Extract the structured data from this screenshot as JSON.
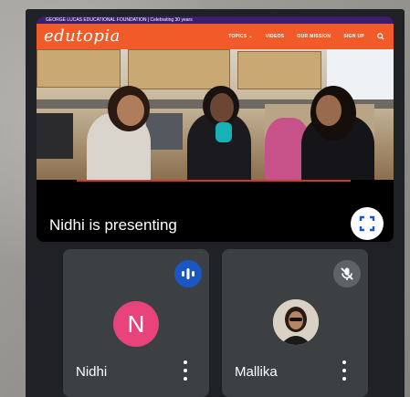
{
  "presentation": {
    "site_banner": "GEORGE LUCAS EDUCATIONAL FOUNDATION  |  Celebrating 30 years",
    "site_logo": "edutopia",
    "nav": [
      "TOPICS ⌄",
      "VIDEOS",
      "OUR MISSION",
      "SIGN UP"
    ],
    "presenter_text": "Nidhi is presenting"
  },
  "participants": [
    {
      "name": "Nidhi",
      "initial": "N",
      "audio": "speaking",
      "avatar_color": "#e8437a"
    },
    {
      "name": "Mallika",
      "audio": "muted"
    }
  ],
  "colors": {
    "background": "#202124",
    "tile": "#3c4043",
    "accent_speaking": "#1a56c4",
    "site_brand": "#f15a29"
  },
  "icons": {
    "fullscreen": "fullscreen-icon",
    "speaking": "audio-level-icon",
    "muted": "mic-off-icon",
    "more": "more-vert-icon",
    "site_search": "search-icon"
  }
}
